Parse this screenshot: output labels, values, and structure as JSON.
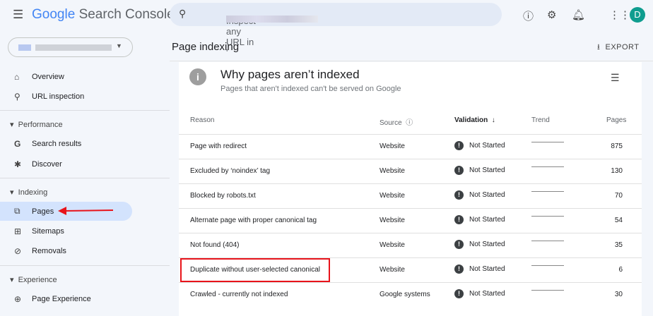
{
  "header": {
    "menu_icon": "hamburger-icon",
    "logo_google": "Google",
    "logo_product": "Search Console",
    "search_placeholder": "Inspect any URL in '",
    "avatar_letter": "D"
  },
  "sidebar": {
    "items": [
      {
        "label": "Overview",
        "icon": "home-icon"
      },
      {
        "label": "URL inspection",
        "icon": "search-icon"
      },
      {
        "section": "Performance"
      },
      {
        "label": "Search results",
        "icon": "google-g-icon"
      },
      {
        "label": "Discover",
        "icon": "asterisk-icon"
      },
      {
        "section": "Indexing"
      },
      {
        "label": "Pages",
        "icon": "pages-icon",
        "selected": true
      },
      {
        "label": "Sitemaps",
        "icon": "sitemap-icon"
      },
      {
        "label": "Removals",
        "icon": "eye-off-icon"
      },
      {
        "section": "Experience"
      },
      {
        "label": "Page Experience",
        "icon": "plus-circle-icon"
      }
    ]
  },
  "main": {
    "title": "Page indexing",
    "export": "EXPORT",
    "card": {
      "title": "Why pages aren’t indexed",
      "subtitle": "Pages that aren't indexed can't be served on Google",
      "columns": [
        "Reason",
        "Source",
        "Validation",
        "Trend",
        "Pages"
      ],
      "rows": [
        {
          "reason": "Page with redirect",
          "source": "Website",
          "validation": "Not Started",
          "pages": "875"
        },
        {
          "reason": "Excluded by ‘noindex’ tag",
          "source": "Website",
          "validation": "Not Started",
          "pages": "130"
        },
        {
          "reason": "Blocked by robots.txt",
          "source": "Website",
          "validation": "Not Started",
          "pages": "70"
        },
        {
          "reason": "Alternate page with proper canonical tag",
          "source": "Website",
          "validation": "Not Started",
          "pages": "54"
        },
        {
          "reason": "Not found (404)",
          "source": "Website",
          "validation": "Not Started",
          "pages": "35"
        },
        {
          "reason": "Duplicate without user-selected canonical",
          "source": "Website",
          "validation": "Not Started",
          "pages": "6",
          "highlighted": true
        },
        {
          "reason": "Crawled - currently not indexed",
          "source": "Google systems",
          "validation": "Not Started",
          "pages": "30"
        }
      ]
    }
  },
  "colors": {
    "selected": "#d3e3fd",
    "annotation": "#e8141b",
    "avatar": "#0f9d8f"
  }
}
